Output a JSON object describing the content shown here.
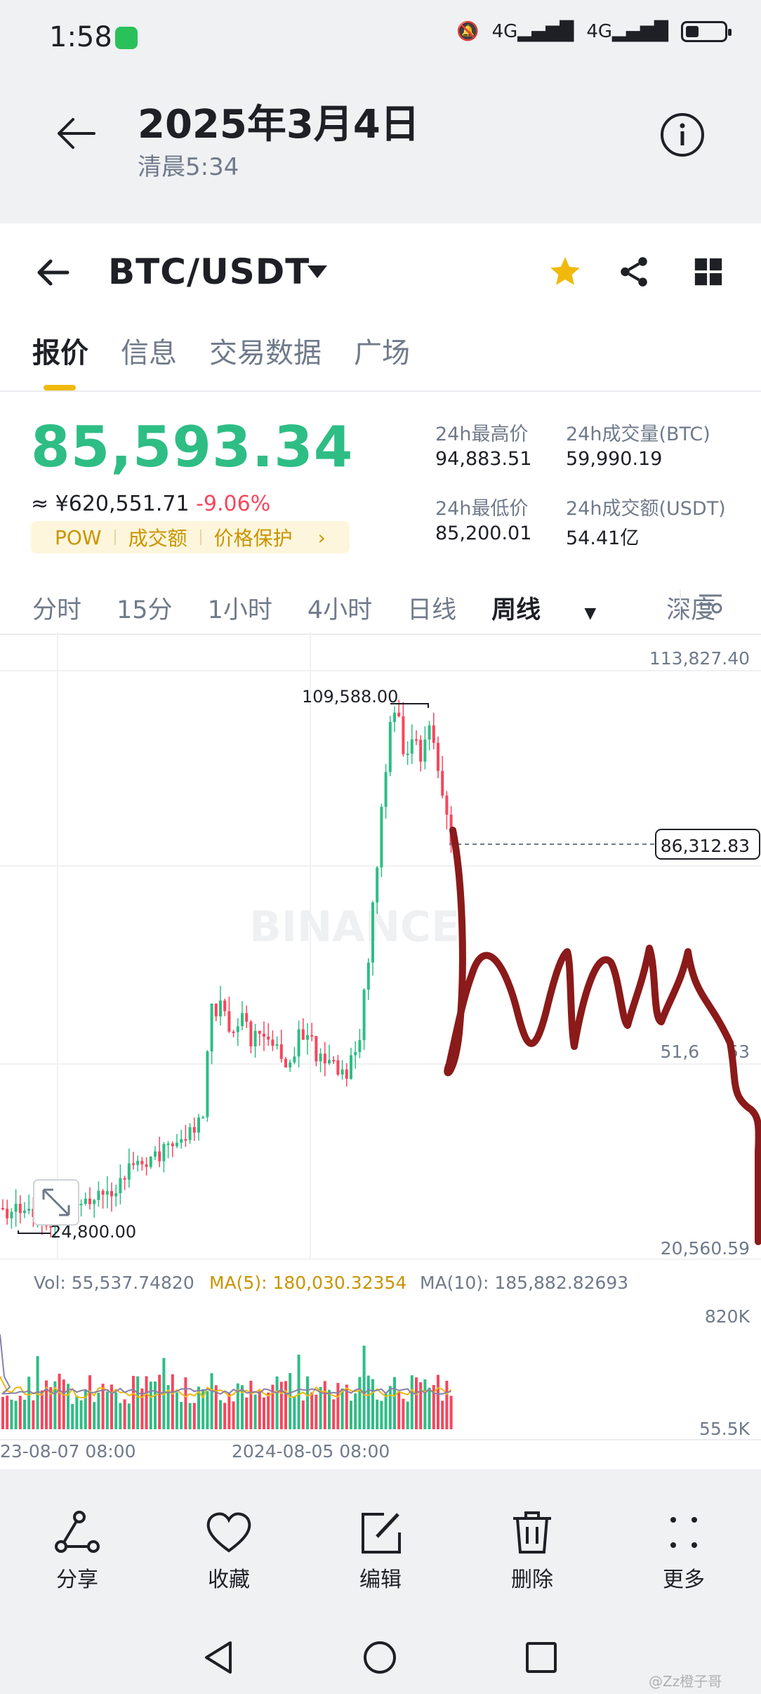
{
  "status_bar": {
    "time": "1:58",
    "signal1": "4G",
    "signal2": "4G"
  },
  "gallery": {
    "date": "2025年3月4日",
    "time": "清晨5:34"
  },
  "app": {
    "pair": "BTC/USDT",
    "tabs": [
      "报价",
      "信息",
      "交易数据",
      "广场"
    ],
    "price": "85,593.34",
    "price_cny": "≈ ¥620,551.71",
    "change": "-9.06%",
    "tags": [
      "POW",
      "成交额",
      "价格保护"
    ],
    "stats": {
      "high_label": "24h最高价",
      "high": "94,883.51",
      "vol_btc_label": "24h成交量(BTC)",
      "vol_btc": "59,990.19",
      "low_label": "24h最低价",
      "low": "85,200.01",
      "vol_usdt_label": "24h成交额(USDT)",
      "vol_usdt": "54.41亿"
    },
    "intervals": [
      "分时",
      "15分",
      "1小时",
      "4小时",
      "日线",
      "周线",
      "深度"
    ],
    "chart": {
      "watermark": "BINANCE",
      "axis_top": "113,827.40",
      "current_price": "86,312.83",
      "axis_mid": "51,6",
      "axis_mid2": "53",
      "axis_bottom": "20,560.59",
      "peak_label": "109,588.00",
      "low_label": "24,800.00",
      "vol_label": "Vol: 55,537.74820",
      "ma5_label": "MA(5): 180,030.32354",
      "ma10_label": "MA(10): 185,882.82693",
      "vol_axis_top": "820K",
      "vol_axis_bottom": "55.5K",
      "date1": "23-08-07 08:00",
      "date2": "2024-08-05 08:00"
    }
  },
  "actions": [
    "分享",
    "收藏",
    "编辑",
    "删除",
    "更多"
  ],
  "watermark_text": "@Zz橙子哥",
  "colors": {
    "up": "#2ebd85",
    "down": "#f6465d",
    "brand": "#f0b90b",
    "ink": "#8b1a1a"
  }
}
